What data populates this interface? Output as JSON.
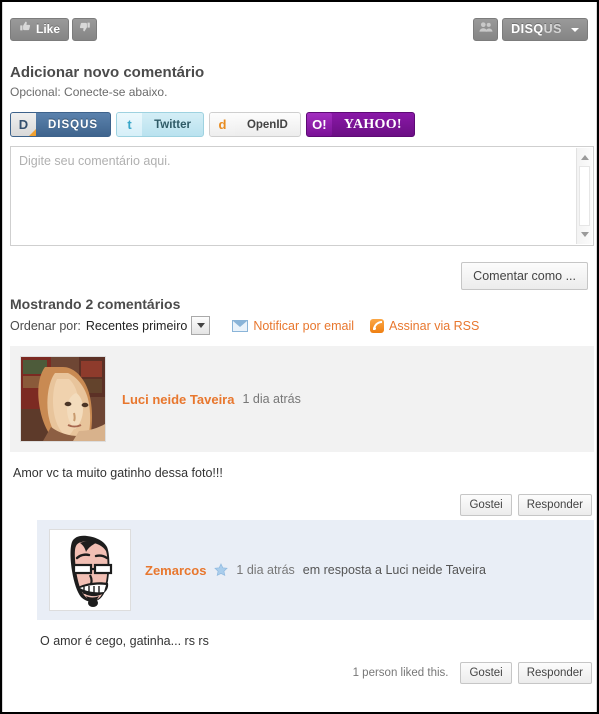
{
  "topbar": {
    "like_label": "Like",
    "like_icon": "thumbs-up-icon",
    "dislike_icon": "thumbs-down-icon",
    "people_icon": "people-icon",
    "brand_strong": "DISQ",
    "brand_dim": "US"
  },
  "add_comment": {
    "heading": "Adicionar novo comentário",
    "subheading": "Opcional: Conecte-se abaixo.",
    "providers": [
      {
        "id": "disqus",
        "icon": "D",
        "label": "DISQUS"
      },
      {
        "id": "twitter",
        "icon": "t",
        "label": "Twitter"
      },
      {
        "id": "openid",
        "icon": "d",
        "label": "OpenID"
      },
      {
        "id": "yahoo",
        "icon": "O!",
        "label": "YAHOO!"
      }
    ],
    "textarea_placeholder": "Digite seu comentário aqui.",
    "submit_label": "Comentar como ..."
  },
  "listing": {
    "showing": "Mostrando 2 comentários",
    "sort_label": "Ordenar por:",
    "sort_value": "Recentes primeiro",
    "notify_label": "Notificar por email",
    "rss_label": "Assinar via RSS"
  },
  "comments": [
    {
      "author": "Luci neide Taveira",
      "time": "1 dia atrás",
      "avatar_type": "photo-avatar",
      "body": "Amor vc ta muito gatinho dessa foto!!!",
      "like_label": "Gostei",
      "reply_label": "Responder"
    },
    {
      "author": "Zemarcos",
      "time": "1 dia atrás",
      "in_reply_to": "em resposta a Luci neide Taveira",
      "avatar_type": "cartoon-avatar",
      "badge_icon": "star-icon",
      "body": "O amor é cego, gatinha... rs rs",
      "liked_count_text": "1 person liked this.",
      "like_label": "Gostei",
      "reply_label": "Responder"
    }
  ],
  "colors": {
    "accent": "#e8772e",
    "header_grey": "#f2f2f2",
    "reply_blue": "#e9eef6"
  }
}
